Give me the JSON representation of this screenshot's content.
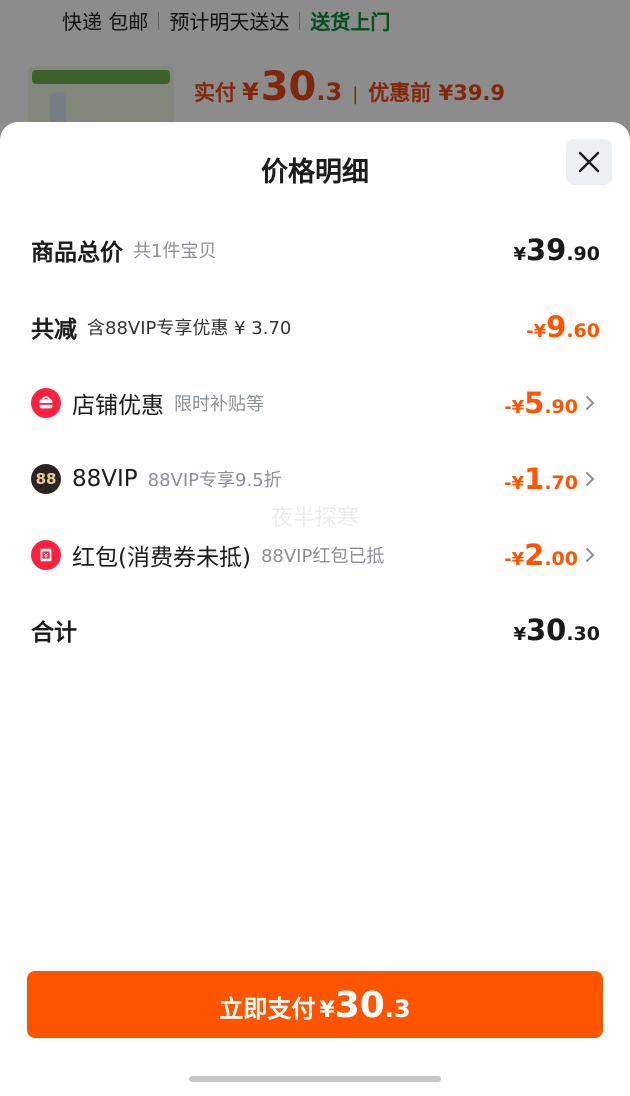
{
  "background": {
    "delivery": [
      "快递 包邮",
      "预计明天送达",
      "送货上门"
    ],
    "price_label": "实付",
    "price_yen": "¥",
    "price_int": "30",
    "price_dec": ".3",
    "price_divider": "|",
    "price_before": "优惠前 ¥39.9"
  },
  "sheet": {
    "title": "价格明细",
    "watermark": "夜半探寒",
    "rows": [
      {
        "name": "商品总价",
        "sub": "共1件宝贝",
        "yen": "¥",
        "int": "39",
        "dec": ".90"
      },
      {
        "name": "共减",
        "sub": "含88VIP专享优惠 ¥ 3.70",
        "yen": "-¥",
        "int": "9",
        "dec": ".60"
      },
      {
        "name": "店铺优惠",
        "sub": "限时补贴等",
        "yen": "-¥",
        "int": "5",
        "dec": ".90",
        "icon": "shop-bag-icon"
      },
      {
        "name": "88VIP",
        "sub": "88VIP专享9.5折",
        "yen": "-¥",
        "int": "1",
        "dec": ".70",
        "icon": "vip-88-icon",
        "icon_text": "88"
      },
      {
        "name": "红包(消费券未抵)",
        "sub": "88VIP红包已抵",
        "yen": "-¥",
        "int": "2",
        "dec": ".00",
        "icon": "red-envelope-icon"
      },
      {
        "name": "合计",
        "yen": "¥",
        "int": "30",
        "dec": ".30"
      }
    ],
    "pay_button": {
      "label": "立即支付",
      "yen": "¥",
      "int": "30",
      "dec": ".3"
    }
  },
  "colors": {
    "accent": "#ff5500",
    "icon_red": "#ff2040",
    "vip_dark": "#2b2522"
  }
}
